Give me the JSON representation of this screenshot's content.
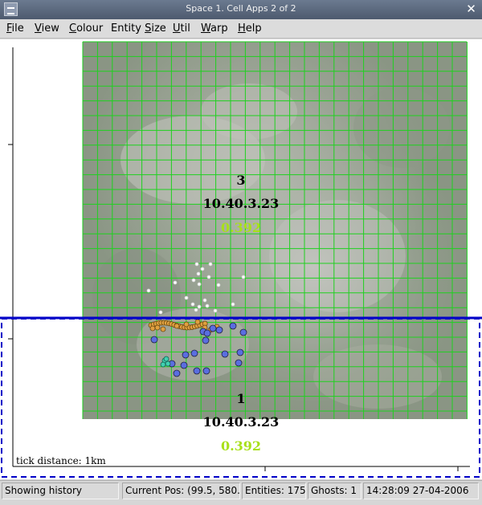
{
  "window": {
    "title": "Space 1. Cell Apps 2 of 2"
  },
  "menu": {
    "file": {
      "lead": "F",
      "rest": "ile"
    },
    "view": {
      "lead": "V",
      "rest": "iew"
    },
    "colour": {
      "lead": "C",
      "rest": "olour"
    },
    "entity_size": {
      "pre": "Entity ",
      "lead": "S",
      "rest": "ize"
    },
    "util": {
      "lead": "U",
      "rest": "til"
    },
    "warp": {
      "lead": "W",
      "rest": "arp"
    },
    "help": {
      "lead": "H",
      "rest": "elp"
    }
  },
  "cells": [
    {
      "id": "3",
      "ip": "10.40.3.23",
      "load": "0.392"
    },
    {
      "id": "1",
      "ip": "10.40.3.23",
      "load": "0.392"
    }
  ],
  "canvas": {
    "tick_label": "tick distance: 1km"
  },
  "colors": {
    "grid": "#1fd11f",
    "cell_boundary": "#0000c8",
    "load_text": "#a8e01a",
    "entity_white": "#ffffff",
    "entity_orange": "#e0a040",
    "entity_blue": "#5a6ee0",
    "entity_teal": "#40d0b0"
  },
  "status": {
    "mode": "Showing history",
    "current_pos": "Current Pos: (99.5, 580.(",
    "entities": "Entities: 175",
    "ghosts": "Ghosts: 1",
    "timestamp": "14:28:09 27-04-2006"
  }
}
